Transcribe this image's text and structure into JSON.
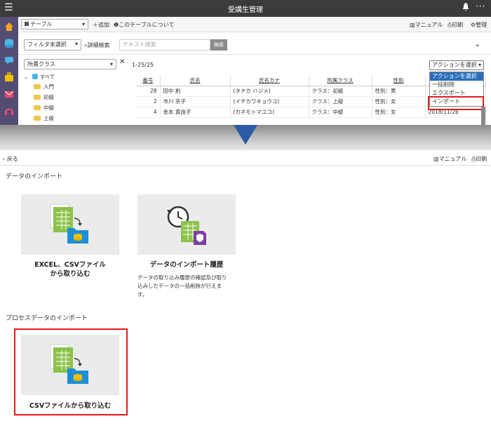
{
  "app": {
    "title": "受講生管理",
    "menu_glyph": "☰",
    "bell_glyph": "🔔",
    "more_glyph": "···"
  },
  "toolbar": {
    "table_select": "テーブル",
    "add": "追加",
    "about": "このテーブルについて",
    "manual": "マニュアル",
    "print": "印刷",
    "admin": "管理"
  },
  "filter": {
    "filter_select": "フィルタ未選択",
    "advanced": "詳細検索",
    "search_placeholder": "テキスト検索",
    "search_button": "検索"
  },
  "tree": {
    "select": "所属クラス",
    "close": "✕",
    "items": [
      "すべて",
      "入門",
      "初級",
      "中級",
      "上級"
    ]
  },
  "table": {
    "count": "1-25/25",
    "headers": [
      "番号",
      "氏名",
      "氏名カナ",
      "所属クラス",
      "性別",
      ""
    ],
    "rows": [
      [
        "28",
        "田中 創",
        "(タナカ ハジメ)",
        "クラス：初級",
        "性別：男",
        ""
      ],
      [
        "2",
        "市川 京子",
        "(イチカワキョウコ)",
        "クラス：上級",
        "性別：女",
        ""
      ],
      [
        "4",
        "金本 真由子",
        "(カネモトマユコ)",
        "クラス：中級",
        "性別：女",
        "2018/11/26"
      ]
    ]
  },
  "action": {
    "select": "アクションを選択",
    "options": [
      "アクションを選択",
      "一括削除",
      "エクスポート",
      "インポート"
    ]
  },
  "bottom": {
    "back": "戻る",
    "manual": "マニュアル",
    "print": "印刷",
    "section1": "データのインポート",
    "card1_title_line1": "EXCEL、CSVファイル",
    "card1_title_line2": "から取り込む",
    "card2_title": "データのインポート履歴",
    "card2_desc": [
      "データの取り込み履歴の確認及び取り",
      "込みしたデータの一括削除が行えま",
      "す。"
    ],
    "section2": "プロセスデータのインポート",
    "card3_title": "CSVファイルから取り込む"
  },
  "colors": {
    "topbar": "#3b3b3b",
    "nav": "#544d73",
    "highlight": "#e21b1b",
    "arrow": "#2b5ba7",
    "dropdown_selected": "#2a6ebb"
  }
}
